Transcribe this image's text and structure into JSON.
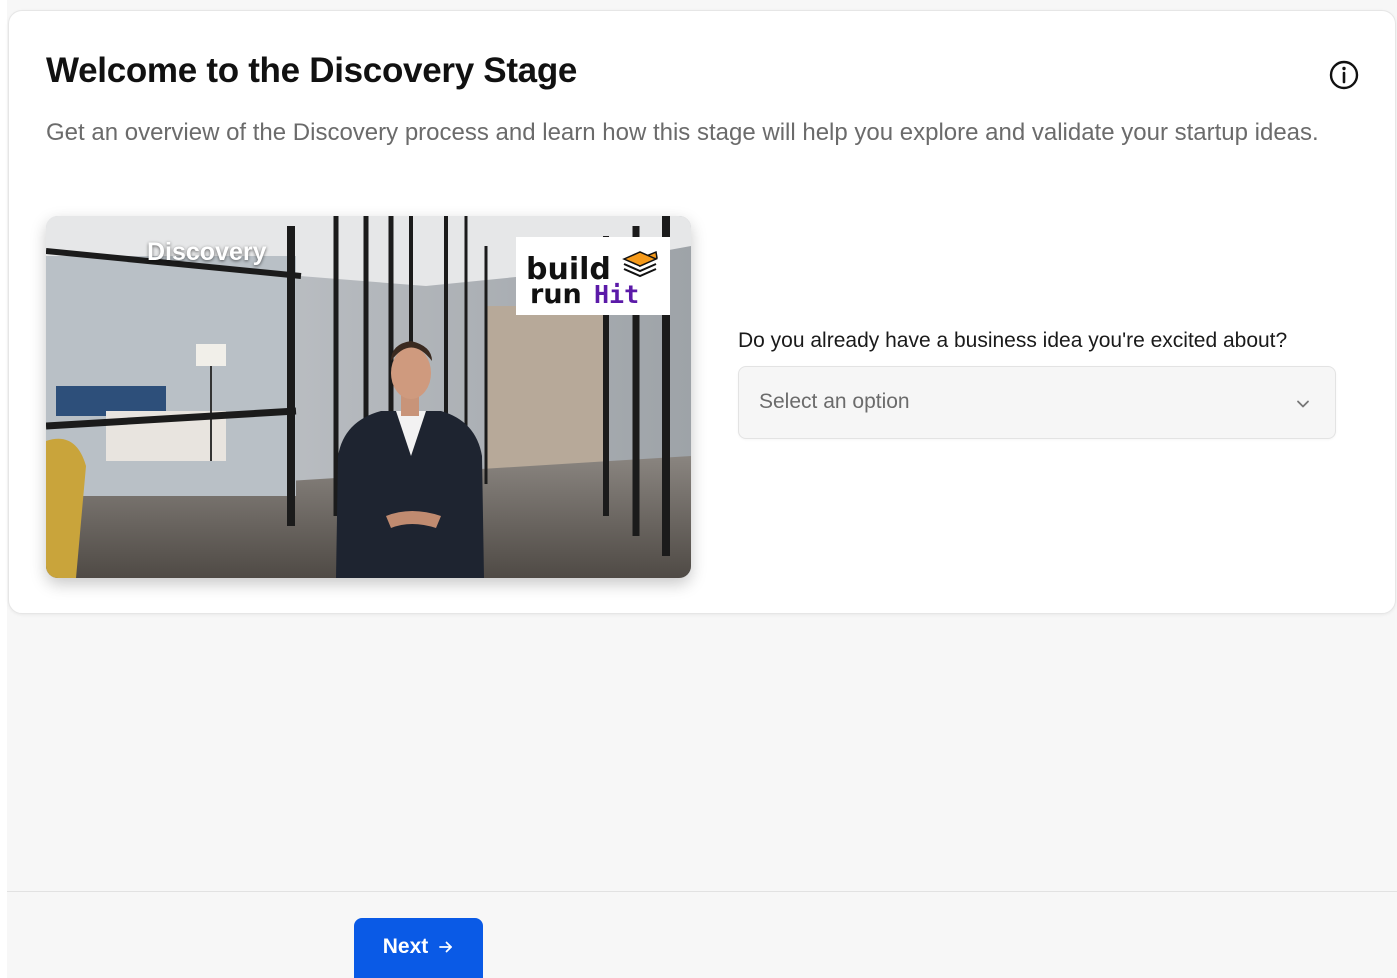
{
  "header": {
    "title": "Welcome to the Discovery Stage",
    "subtitle": "Get an overview of the Discovery process and learn how this stage will help you explore and validate your startup ideas."
  },
  "video": {
    "label": "Discovery",
    "logo_line1": "build",
    "logo_line2_a": "run",
    "logo_line2_b": "Hit"
  },
  "question": {
    "label": "Do you already have a business idea you're excited about?",
    "placeholder": "Select an option"
  },
  "footer": {
    "next_label": "Next"
  },
  "icons": {
    "info": "info-icon",
    "chevron": "chevron-down-icon",
    "arrow": "arrow-right-icon"
  },
  "colors": {
    "accent": "#0a5ae6",
    "logo_purple": "#5b1aa8",
    "logo_orange": "#f59a1b"
  }
}
